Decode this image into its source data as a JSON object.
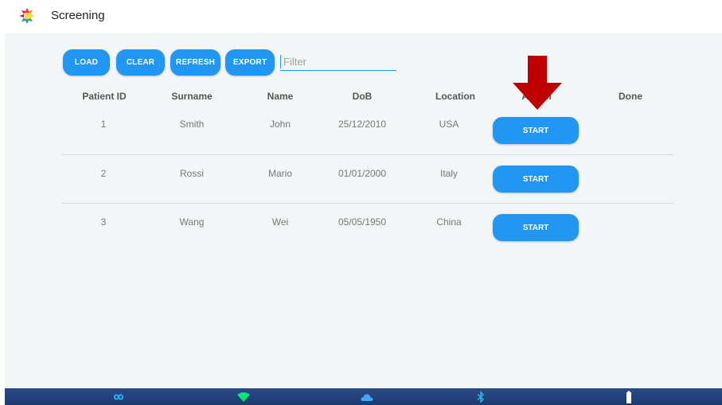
{
  "header": {
    "title": "Screening"
  },
  "toolbar": {
    "load_label": "LOAD",
    "clear_label": "CLEAR",
    "refresh_label": "REFRESH",
    "export_label": "EXPORT",
    "filter_placeholder": "Filter",
    "filter_value": ""
  },
  "table": {
    "columns": [
      "Patient ID",
      "Surname",
      "Name",
      "DoB",
      "Location",
      "Action",
      "Done"
    ],
    "rows": [
      {
        "id": "1",
        "surname": "Smith",
        "name": "John",
        "dob": "25/12/2010",
        "location": "USA",
        "action_label": "START",
        "done": ""
      },
      {
        "id": "2",
        "surname": "Rossi",
        "name": "Mario",
        "dob": "01/01/2000",
        "location": "Italy",
        "action_label": "START",
        "done": ""
      },
      {
        "id": "3",
        "surname": "Wang",
        "name": "Wei",
        "dob": "05/05/1950",
        "location": "China",
        "action_label": "START",
        "done": ""
      }
    ]
  },
  "annotation": {
    "icon": "arrow-down-icon",
    "color": "#c00000"
  },
  "status_bar": {
    "icons": [
      "infinity-icon",
      "wifi-icon",
      "cloud-icon",
      "bluetooth-icon",
      "battery-icon"
    ],
    "background": "#1e3a70",
    "icon_color": "#29b6f6"
  },
  "colors": {
    "accent": "#2196f3",
    "panel_background": "#f2f6f7"
  }
}
